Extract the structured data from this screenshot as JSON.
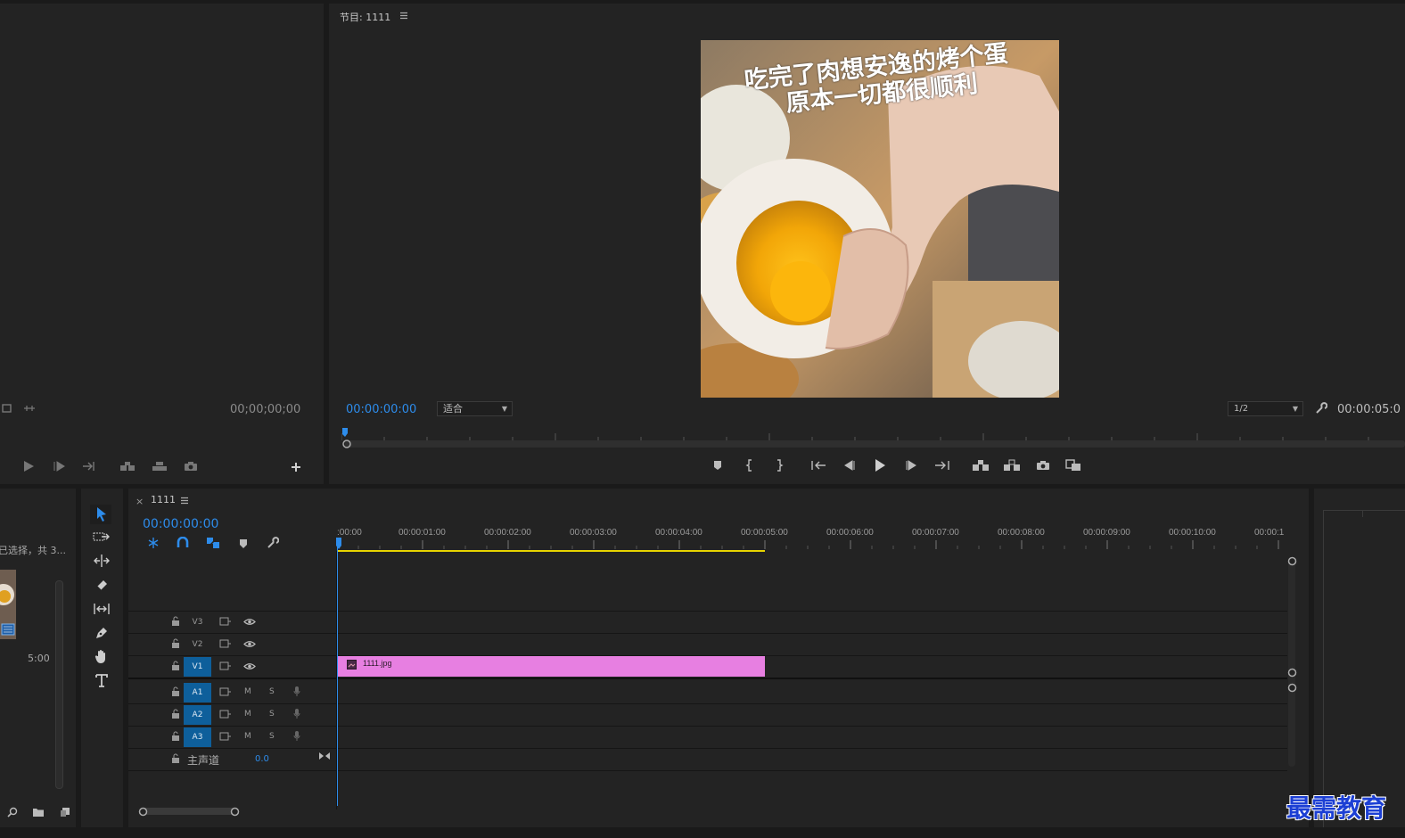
{
  "source_monitor": {
    "timecode": "00;00;00;00"
  },
  "program_monitor": {
    "title": "节目: 1111",
    "menu_icon": "hamburger-icon",
    "timecode": "00:00:00:00",
    "zoom_select": "适合",
    "resolution_select": "1/2",
    "duration": "00:00:05:0",
    "caption_line1": "吃完了肉想安逸的烤个蛋",
    "caption_line2": "原本一切都很顺利"
  },
  "project_panel": {
    "status_text": "已选择，共 3...",
    "item_duration": "5:00"
  },
  "timeline": {
    "sequence_name": "1111",
    "close_label": "×",
    "timecode": "00:00:00:00",
    "ruler_labels": [
      ":00:00",
      "00:00:01:00",
      "00:00:02:00",
      "00:00:03:00",
      "00:00:04:00",
      "00:00:05:00",
      "00:00:06:00",
      "00:00:07:00",
      "00:00:08:00",
      "00:00:09:00",
      "00:00:10:00",
      "00:00:1"
    ],
    "video_tracks": [
      "V3",
      "V2",
      "V1"
    ],
    "audio_tracks": [
      "A1",
      "A2",
      "A3"
    ],
    "mute_label": "M",
    "solo_label": "S",
    "master_label": "主声道",
    "master_value": "0.0",
    "clip_name": "1111.jpg",
    "clip_color": "#e77fe1"
  },
  "watermark": "最需教育",
  "colors": {
    "accent": "#2d8ceb",
    "work_area": "#e6d300",
    "track_active": "#0e5f9b"
  }
}
